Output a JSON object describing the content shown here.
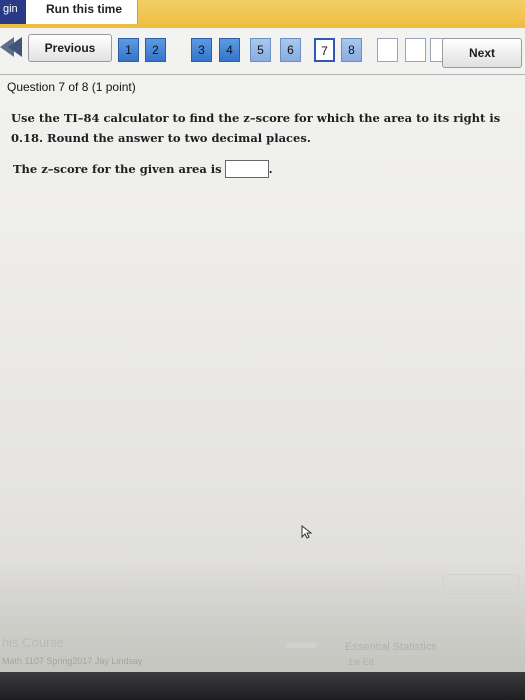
{
  "topbar": {
    "login_text": "gin",
    "run_label": "Run this time"
  },
  "nav": {
    "previous_label": "Previous",
    "next_label": "Next",
    "questions": [
      {
        "label": "1",
        "state": "answered"
      },
      {
        "label": "2",
        "state": "answered"
      },
      {
        "label": "3",
        "state": "answered"
      },
      {
        "label": "4",
        "state": "answered"
      },
      {
        "label": "5",
        "state": "light"
      },
      {
        "label": "6",
        "state": "light"
      },
      {
        "label": "7",
        "state": "current"
      },
      {
        "label": "8",
        "state": "light"
      },
      {
        "label": "",
        "state": "empty"
      },
      {
        "label": "",
        "state": "empty"
      },
      {
        "label": "",
        "state": "empty"
      }
    ]
  },
  "question": {
    "header": "Question 7 of 8 (1 point)",
    "text": "Use the TI–84 calculator to find the z–score for which the area to its right is 0.18. Round the answer to two decimal places.",
    "answer_prefix": "The z–score for the given area is",
    "answer_suffix": ".",
    "answer_value": ""
  },
  "footer": {
    "course_label": "his Course",
    "course_info": "Math 1107 Spring2017 Jay Lindsay",
    "book_title": "Essential Statistics",
    "book_edition": "1st Ed"
  },
  "colors": {
    "topbar": "#eebd3e",
    "login_bg": "#2a3a87",
    "nav_blue": "#3474c9"
  }
}
